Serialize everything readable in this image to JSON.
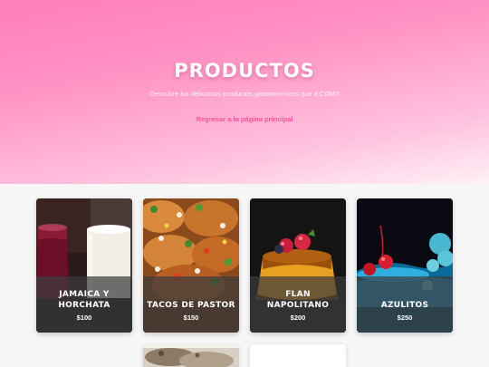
{
  "hero": {
    "title": "PRODUCTOS",
    "subtitle": "Descubre los deliciosos productos gastronómicos que a CDMX",
    "back_link": "Regresar a la página principal"
  },
  "products": [
    {
      "name": "JAMAICA Y HORCHATA",
      "price": "$100",
      "image": "jamaica-horchata-drinks"
    },
    {
      "name": "TACOS DE PASTOR",
      "price": "$150",
      "image": "tacos-pastor"
    },
    {
      "name": "FLAN NAPOLITANO",
      "price": "$200",
      "image": "flan-napolitano"
    },
    {
      "name": "AZULITOS",
      "price": "$250",
      "image": "azulitos-drink"
    }
  ],
  "colors": {
    "accent": "#ff4f9a",
    "hero_top": "#ff7fb8",
    "hero_bottom": "#fff1f7",
    "page_bg": "#f6f6f6"
  }
}
